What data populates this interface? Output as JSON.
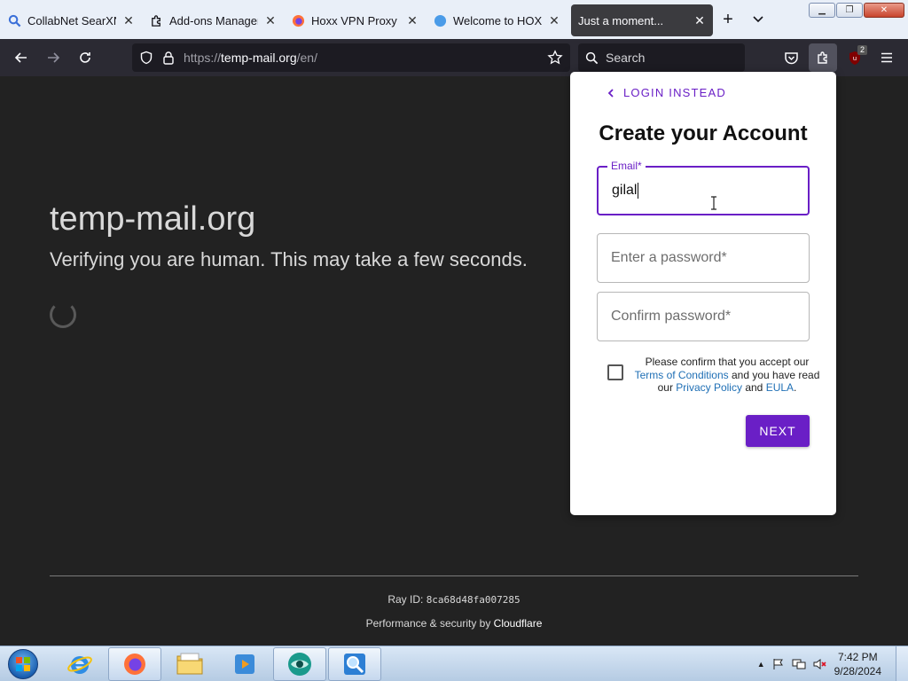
{
  "tabs": [
    {
      "title": "CollabNet SearXNG",
      "icon": "search-icon"
    },
    {
      "title": "Add-ons Manager",
      "icon": "puzzle-icon"
    },
    {
      "title": "Hoxx VPN Proxy – G",
      "icon": "firefox-icon"
    },
    {
      "title": "Welcome to HOXX",
      "icon": "globe-icon"
    },
    {
      "title": "Just a moment...",
      "icon": "",
      "active": true
    }
  ],
  "navbar": {
    "url_prefix": "https://",
    "url_host": "temp-mail.org",
    "url_path": "/en/",
    "search_placeholder": "Search",
    "badge_count": "2"
  },
  "page": {
    "site_title": "temp-mail.org",
    "verify_text": "Verifying you are human. This may take a few seconds.",
    "ray_label": "Ray ID:",
    "ray_id": "8ca68d48fa007285",
    "perf_label": "Performance & security by",
    "perf_brand": "Cloudflare"
  },
  "popup": {
    "login_label": "LOGIN INSTEAD",
    "title": "Create your Account",
    "email_label": "Email*",
    "email_value": "gilal",
    "password_placeholder": "Enter a password*",
    "confirm_placeholder": "Confirm password*",
    "terms_prefix": "Please confirm that you accept our",
    "terms_link": "Terms of Conditions",
    "terms_mid": "and you have read our",
    "privacy_link": "Privacy Policy",
    "terms_and": "and",
    "eula_link": "EULA",
    "terms_end": ".",
    "next_label": "NEXT"
  },
  "taskbar": {
    "time": "7:42 PM",
    "date": "9/28/2024"
  },
  "colors": {
    "accent": "#6a1fc6",
    "page_bg": "#222222",
    "link": "#1f6fb5"
  }
}
